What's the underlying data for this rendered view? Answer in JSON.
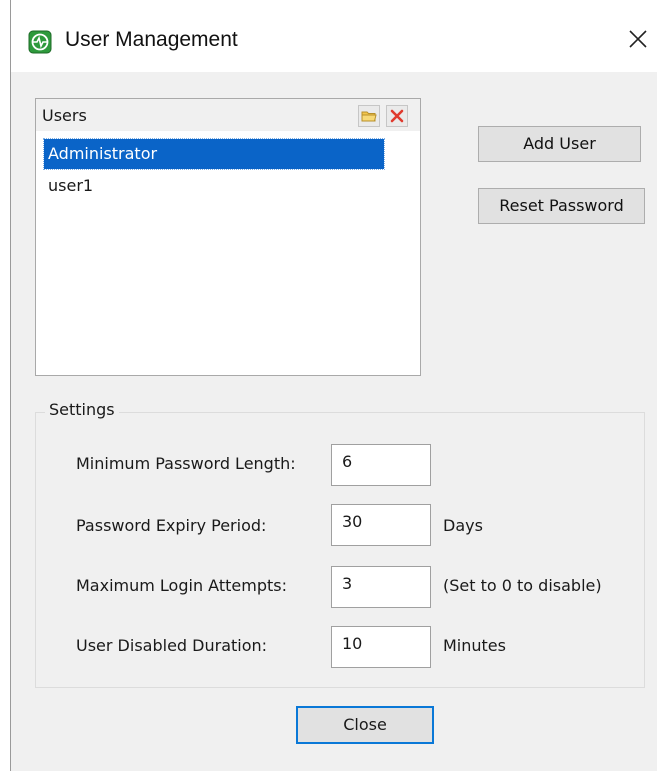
{
  "window": {
    "title": "User Management",
    "icon": "app-logo-icon",
    "close_icon": "close-icon"
  },
  "users": {
    "title": "Users",
    "header_buttons": [
      "open-folder-icon",
      "delete-x-icon"
    ],
    "items": [
      {
        "label": "Administrator",
        "selected": true
      },
      {
        "label": "user1",
        "selected": false
      }
    ]
  },
  "actions": {
    "add_user": "Add User",
    "reset_password": "Reset Password"
  },
  "settings": {
    "title": "Settings",
    "rows": [
      {
        "label": "Minimum Password Length:",
        "value": "6",
        "unit": ""
      },
      {
        "label": "Password Expiry Period:",
        "value": "30",
        "unit": "Days"
      },
      {
        "label": "Maximum Login Attempts:",
        "value": "3",
        "unit": "(Set to 0 to disable)"
      },
      {
        "label": "User Disabled Duration:",
        "value": "10",
        "unit": "Minutes"
      }
    ]
  },
  "footer": {
    "close": "Close"
  },
  "colors": {
    "selection": "#0a64c8",
    "dialog_bg": "#f0f0f0",
    "focus_border": "#0a78d7",
    "logo_green": "#2e9a3c"
  }
}
